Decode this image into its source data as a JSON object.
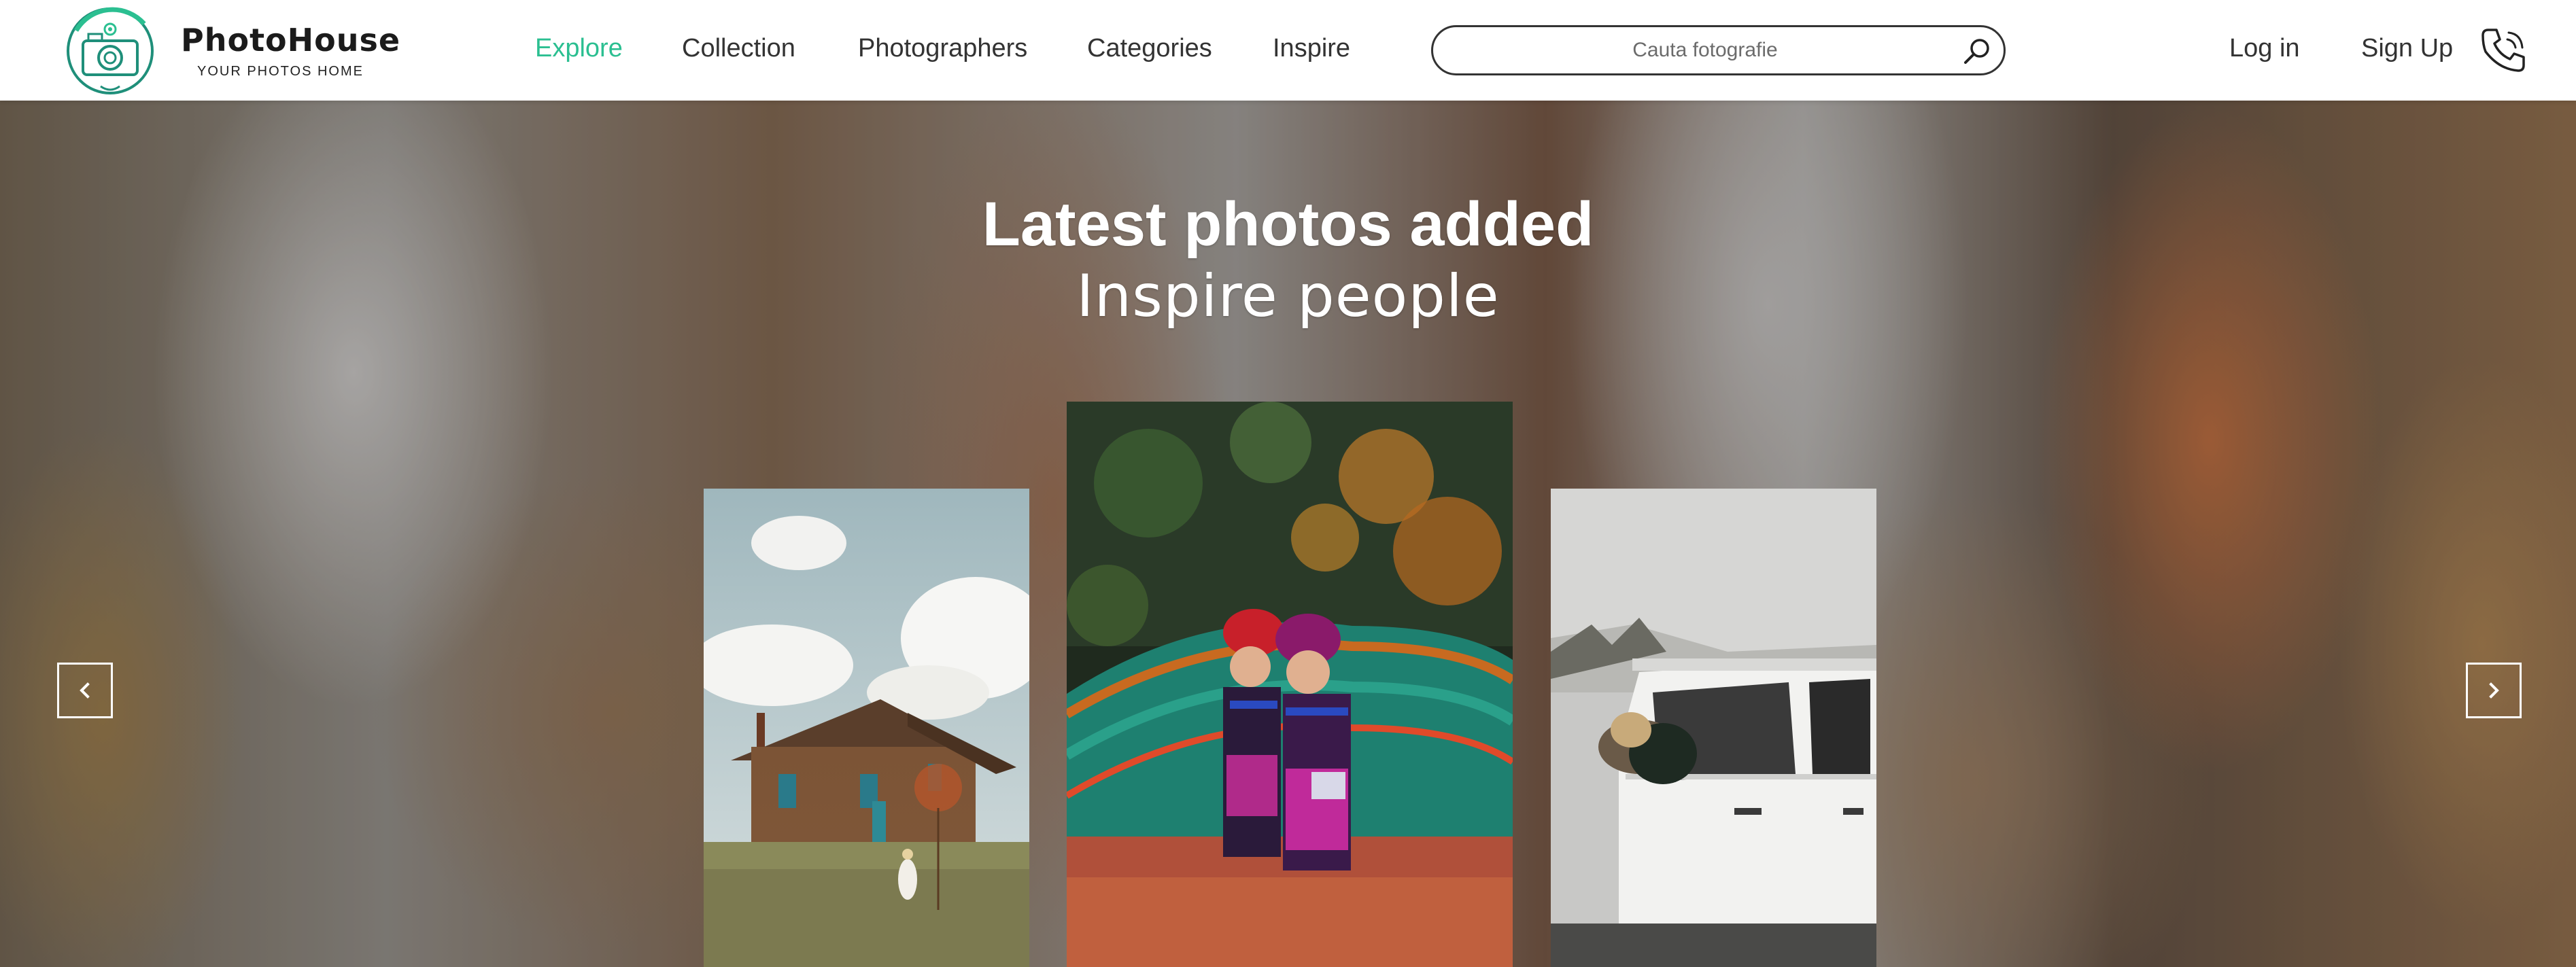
{
  "brand": {
    "name": "PhotoHouse",
    "tagline": "YOUR PHOTOS   HOME",
    "accent": "#2bbf91"
  },
  "nav": {
    "items": [
      {
        "label": "Explore",
        "active": true
      },
      {
        "label": "Collection",
        "active": false
      },
      {
        "label": "Photographers",
        "active": false
      },
      {
        "label": "Categories",
        "active": false
      },
      {
        "label": "Inspire",
        "active": false
      }
    ]
  },
  "search": {
    "placeholder": "Cauta fotografie",
    "value": "",
    "icon": "search-icon"
  },
  "auth": {
    "login": "Log in",
    "signup": "Sign Up",
    "phone_icon": "phone-icon"
  },
  "hero": {
    "title": "Latest photos added",
    "subtitle": "Inspire people",
    "prev_icon": "chevron-left-icon",
    "next_icon": "chevron-right-icon"
  }
}
